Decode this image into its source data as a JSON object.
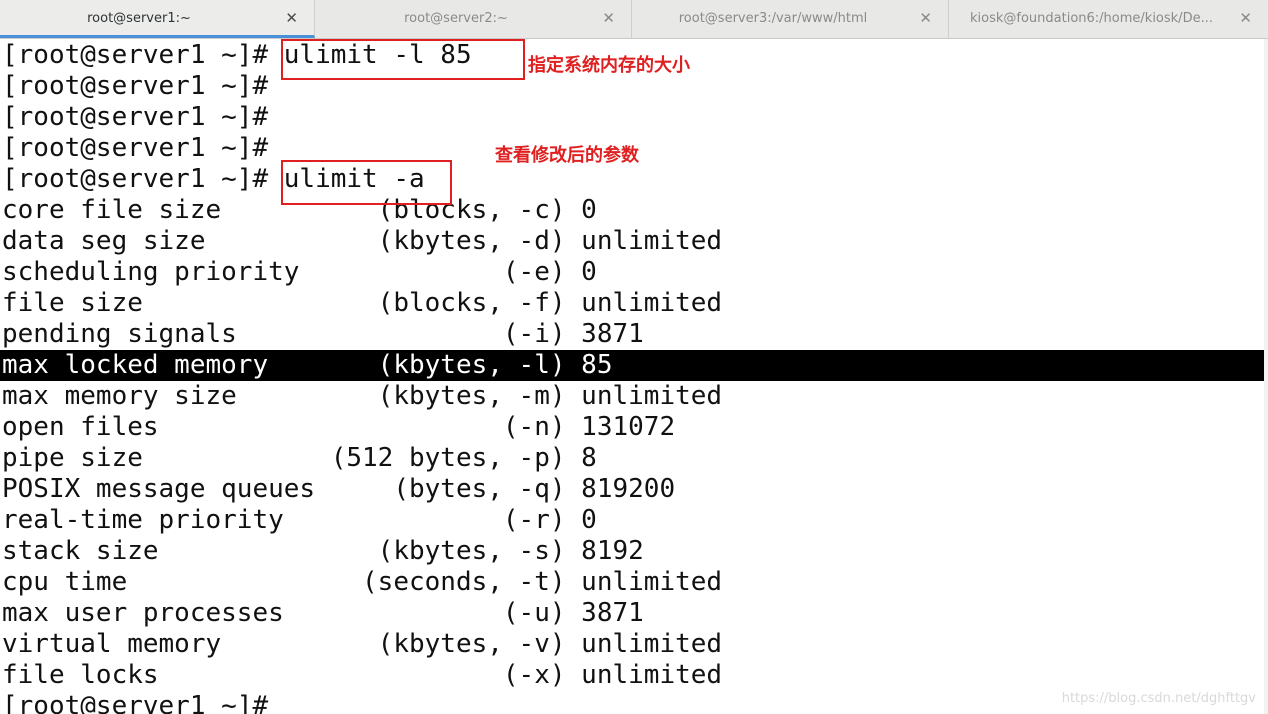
{
  "tabs": [
    {
      "label": "root@server1:~",
      "active": true
    },
    {
      "label": "root@server2:~",
      "active": false
    },
    {
      "label": "root@server3:/var/www/html",
      "active": false
    },
    {
      "label": "kiosk@foundation6:/home/kiosk/De...",
      "active": false
    }
  ],
  "close_glyph": "✕",
  "terminal": {
    "lines": [
      "[root@server1 ~]# ulimit -l 85",
      "[root@server1 ~]#",
      "[root@server1 ~]#",
      "[root@server1 ~]#",
      "[root@server1 ~]# ulimit -a",
      "core file size          (blocks, -c) 0",
      "data seg size           (kbytes, -d) unlimited",
      "scheduling priority             (-e) 0",
      "file size               (blocks, -f) unlimited",
      "pending signals                 (-i) 3871",
      "max locked memory       (kbytes, -l) 85",
      "max memory size         (kbytes, -m) unlimited",
      "open files                      (-n) 131072",
      "pipe size            (512 bytes, -p) 8",
      "POSIX message queues     (bytes, -q) 819200",
      "real-time priority              (-r) 0",
      "stack size              (kbytes, -s) 8192",
      "cpu time               (seconds, -t) unlimited",
      "max user processes              (-u) 3871",
      "virtual memory          (kbytes, -v) unlimited",
      "file locks                      (-x) unlimited",
      "[root@server1 ~]#"
    ],
    "highlighted_line": 10
  },
  "annotations": [
    {
      "text": "指定系统内存的大小"
    },
    {
      "text": "查看修改后的参数"
    }
  ],
  "watermark": "https://blog.csdn.net/dghfttgv",
  "colors": {
    "annotation": "#e02020",
    "tab_accent": "#4a90d9",
    "highlight_bg": "#000000"
  }
}
